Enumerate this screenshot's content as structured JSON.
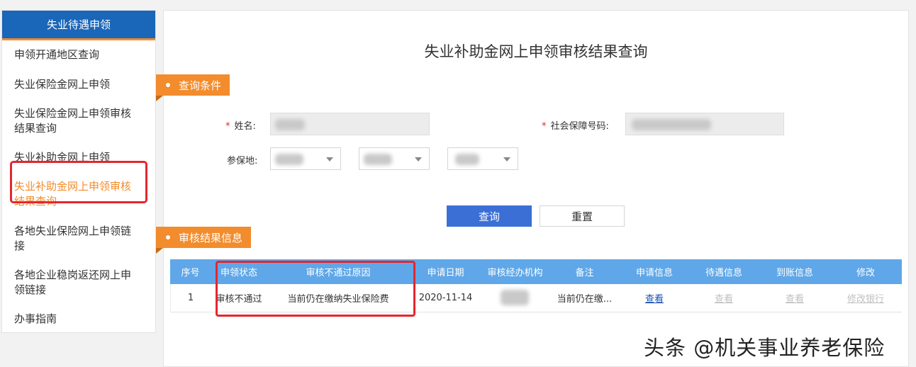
{
  "sidebar": {
    "header": "失业待遇申领",
    "items": [
      {
        "label_lines": [
          "申领开通地区查询"
        ]
      },
      {
        "label_lines": [
          "失业保险金网上申领"
        ]
      },
      {
        "label_lines": [
          "失业保险金网上申领审核",
          "结果查询"
        ]
      },
      {
        "label_lines": [
          "失业补助金网上申领"
        ]
      },
      {
        "label_lines": [
          "失业补助金网上申领审核",
          "结果查询"
        ],
        "active": true
      },
      {
        "label_lines": [
          "各地失业保险网上申领链",
          "接"
        ]
      },
      {
        "label_lines": [
          "各地企业稳岗返还网上申",
          "领链接"
        ]
      },
      {
        "label_lines": [
          "办事指南"
        ]
      }
    ]
  },
  "page": {
    "title": "失业补助金网上申领审核结果查询"
  },
  "query_section": {
    "tag": "查询条件",
    "name_label": "姓名:",
    "ssn_label": "社会保障号码:",
    "insured_place_label": "参保地:",
    "required_mark": "*",
    "query_button": "查询",
    "reset_button": "重置"
  },
  "result_section": {
    "tag": "审核结果信息",
    "columns": [
      "序号",
      "申领状态",
      "审核不通过原因",
      "申请日期",
      "审核经办机构",
      "备注",
      "申请信息",
      "待遇信息",
      "到账信息",
      "修改"
    ],
    "rows": [
      {
        "index": "1",
        "status": "审核不通过",
        "reason": "当前仍在缴纳失业保险费",
        "date": "2020-11-14",
        "agency": "",
        "remark": "当前仍在缴...",
        "apply_info": "查看",
        "benefit_info": "查看",
        "account_info": "查看",
        "modify": "修改银行"
      }
    ]
  },
  "watermark": "头条 @机关事业养老保险",
  "colors": {
    "brand_blue": "#1a66b8",
    "accent_orange": "#f28c2c",
    "table_header": "#5fa7e8",
    "primary_button": "#3b6fd6",
    "highlight_red": "#e6262d"
  }
}
